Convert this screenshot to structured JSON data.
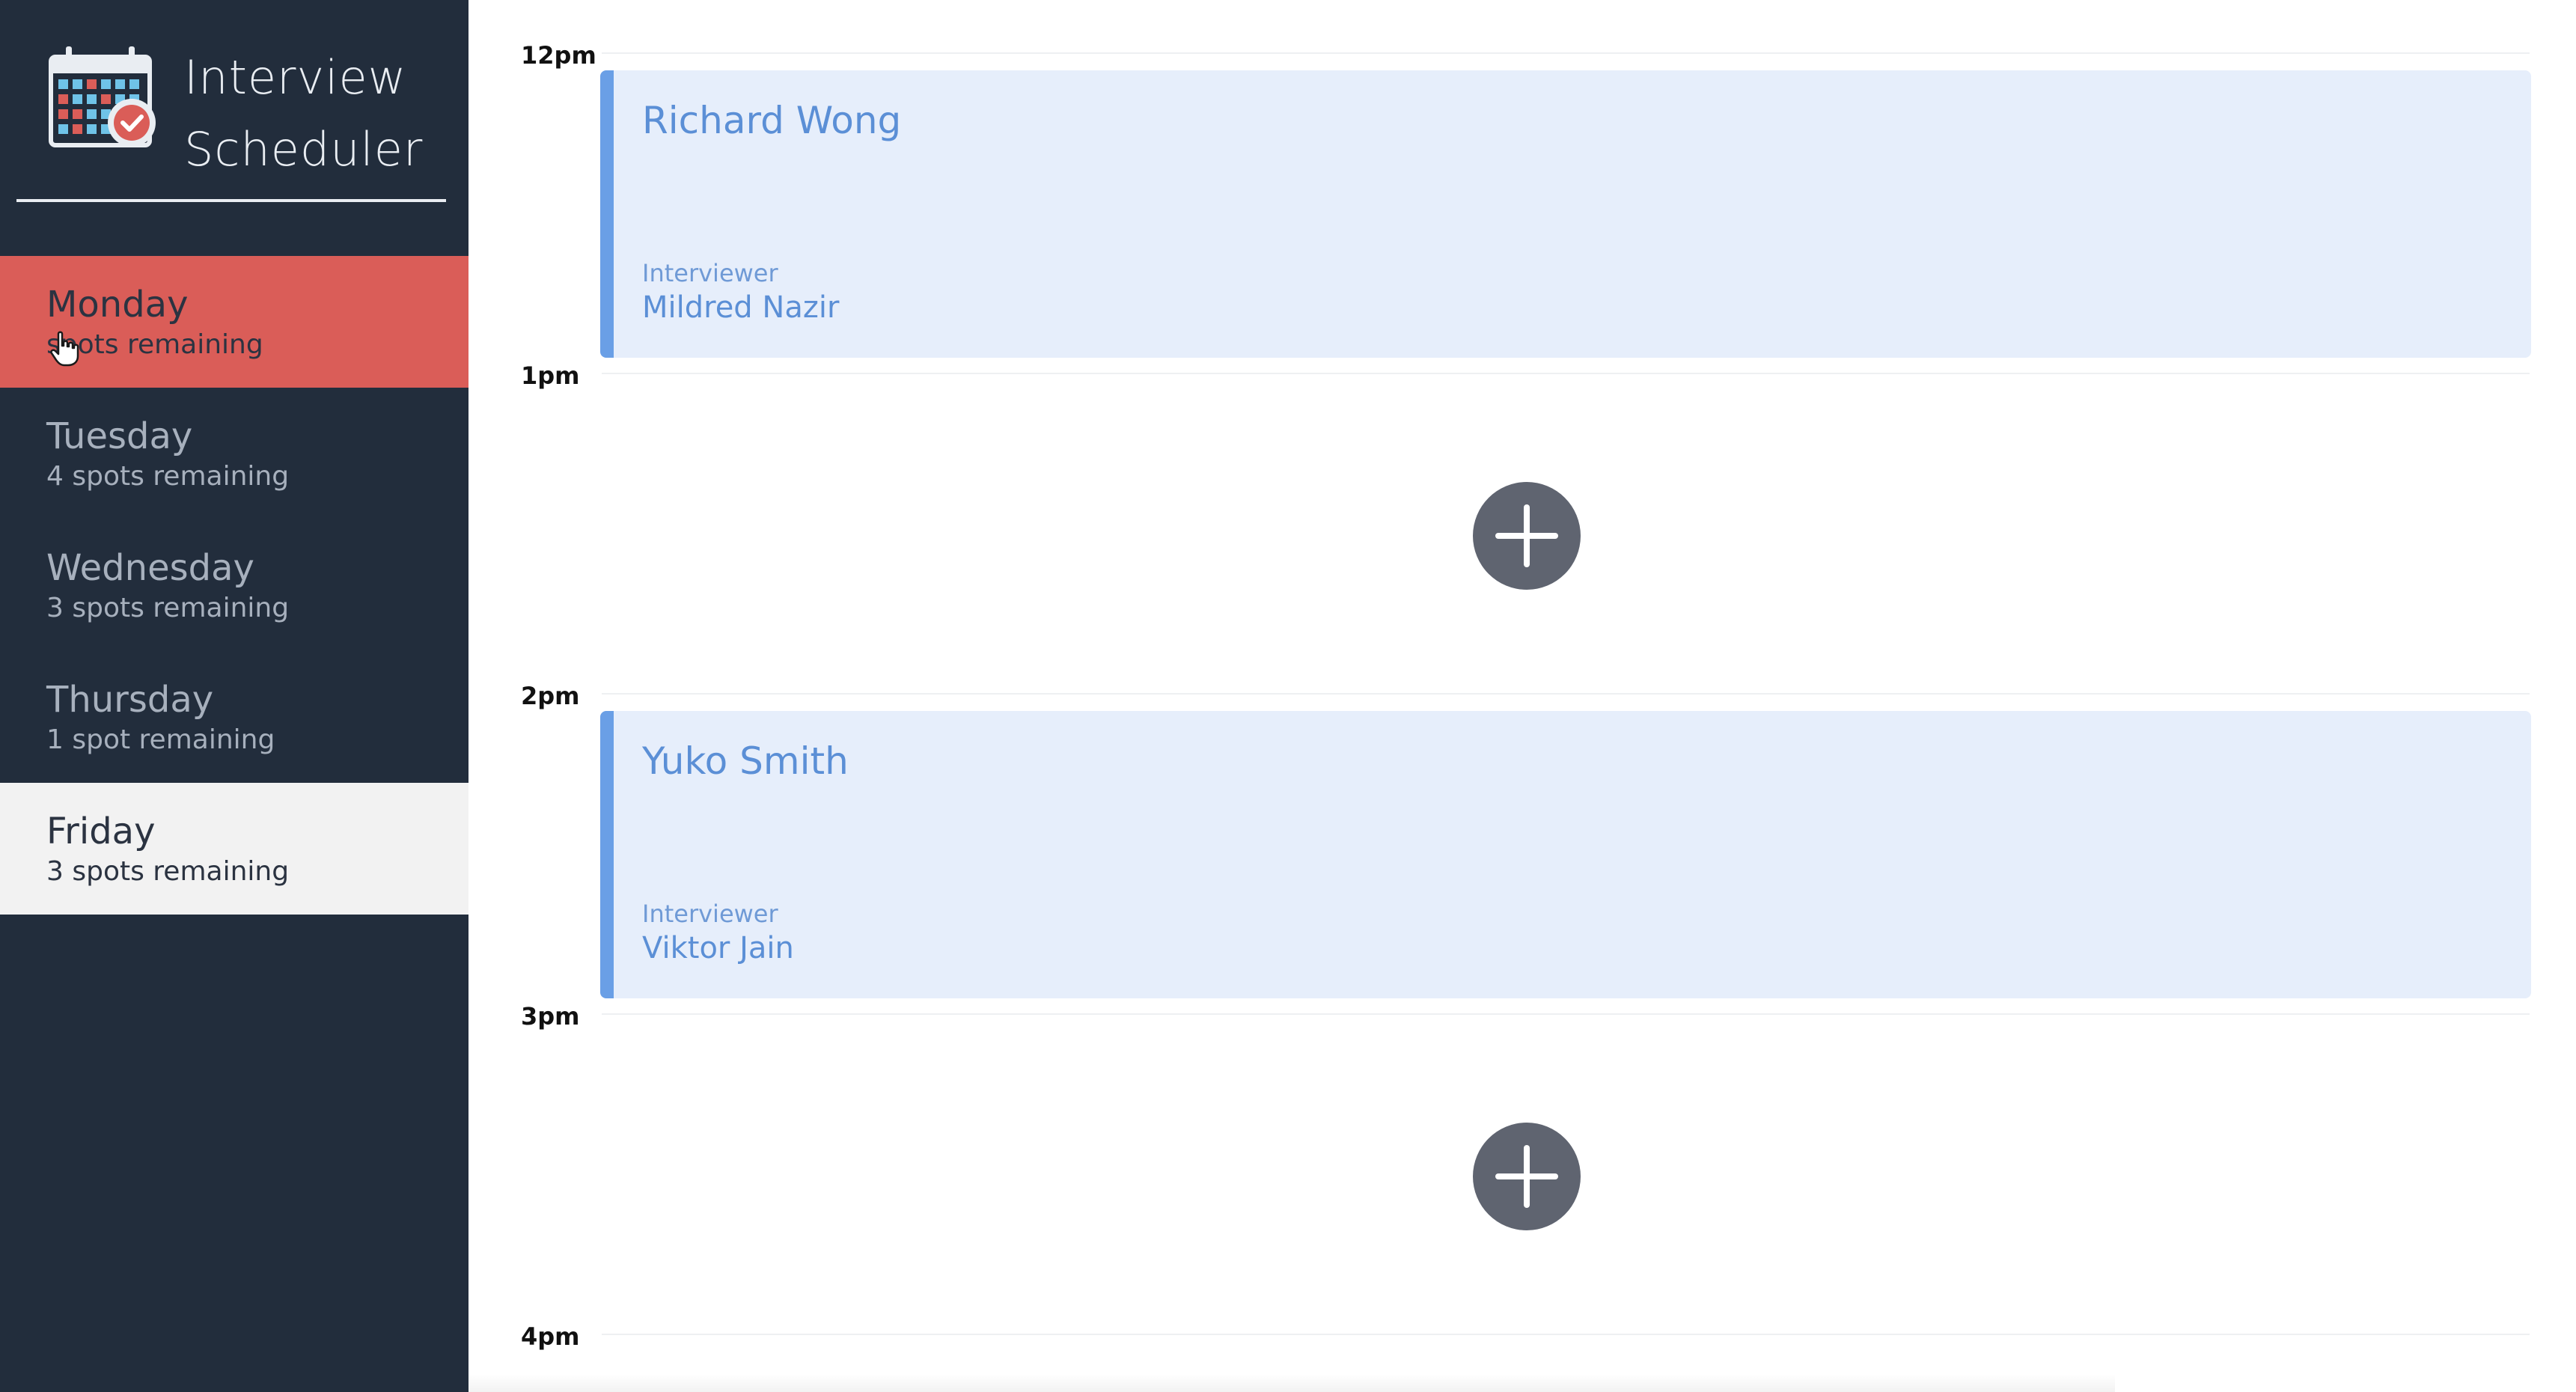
{
  "brand": {
    "title_line1": "Interview",
    "title_line2": "Scheduler",
    "logo_icon": "calendar-check-icon"
  },
  "sidebar": {
    "days": [
      {
        "name": "Monday",
        "spots": "spots remaining",
        "state": "hover"
      },
      {
        "name": "Tuesday",
        "spots": "4 spots remaining",
        "state": "default"
      },
      {
        "name": "Wednesday",
        "spots": "3 spots remaining",
        "state": "default"
      },
      {
        "name": "Thursday",
        "spots": "1 spot remaining",
        "state": "default"
      },
      {
        "name": "Friday",
        "spots": "3 spots remaining",
        "state": "selected"
      }
    ]
  },
  "schedule": {
    "slots": [
      {
        "time": "12pm",
        "appointment": {
          "student": "Richard Wong",
          "interviewer_label": "Interviewer",
          "interviewer": "Mildred Nazir"
        }
      },
      {
        "time": "1pm",
        "appointment": null,
        "add_icon": "plus-icon"
      },
      {
        "time": "2pm",
        "appointment": {
          "student": "Yuko Smith",
          "interviewer_label": "Interviewer",
          "interviewer": "Viktor Jain"
        }
      },
      {
        "time": "3pm",
        "appointment": null,
        "add_icon": "plus-icon"
      },
      {
        "time": "4pm",
        "appointment": null
      }
    ]
  },
  "colors": {
    "sidebar_bg": "#222d3c",
    "hover_day_bg": "#da5d58",
    "selected_day_bg": "#f2f2f2",
    "appointment_bg": "#e6eefb",
    "appointment_accent": "#6a9fe6",
    "add_button": "#5f6470"
  }
}
